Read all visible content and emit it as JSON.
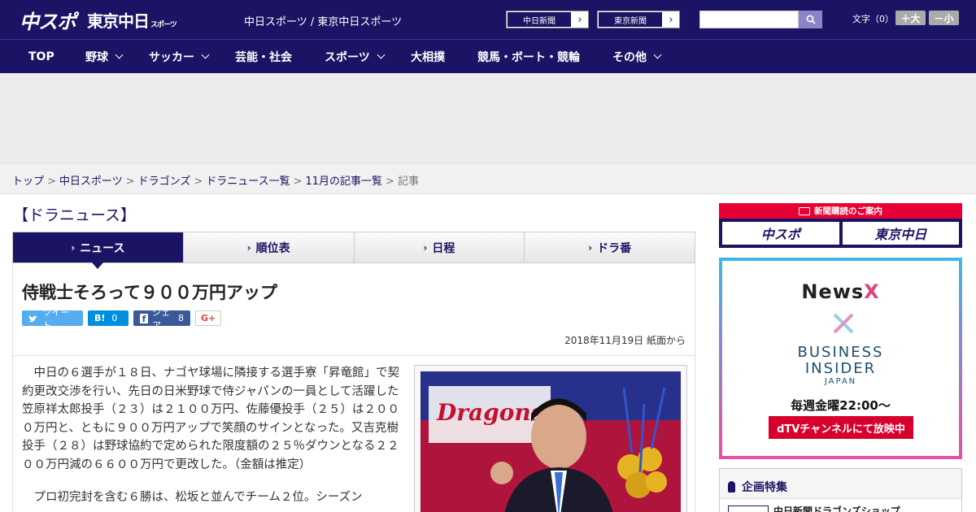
{
  "header": {
    "logo_chuspo": "中スポ",
    "logo_tokyo": "東京中日",
    "logo_tokyo_suffix": "スポーツ",
    "site_name": "中日スポーツ / 東京中日スポーツ",
    "ext_links": [
      {
        "label": "中日新聞",
        "arrow": "›"
      },
      {
        "label": "東京新聞",
        "arrow": "›"
      }
    ],
    "search_placeholder": "",
    "fontsize_label": "文字（0）",
    "fontsize_up": "＋大",
    "fontsize_down": "－小"
  },
  "nav": [
    {
      "label": "TOP",
      "has_menu": false
    },
    {
      "label": "野球",
      "has_menu": true
    },
    {
      "label": "サッカー",
      "has_menu": true
    },
    {
      "label": "芸能・社会",
      "has_menu": false
    },
    {
      "label": "スポーツ",
      "has_menu": true
    },
    {
      "label": "大相撲",
      "has_menu": false
    },
    {
      "label": "競馬・ボート・競輪",
      "has_menu": false
    },
    {
      "label": "その他",
      "has_menu": true
    }
  ],
  "breadcrumb": {
    "items": [
      "トップ",
      "中日スポーツ",
      "ドラゴンズ",
      "ドラニュース一覧",
      "11月の記事一覧"
    ],
    "separator": ">",
    "current": "記事"
  },
  "section_title": "【ドラニュース】",
  "tabs": [
    {
      "label": "ニュース",
      "caret": "›",
      "active": true
    },
    {
      "label": "順位表",
      "caret": "›",
      "active": false
    },
    {
      "label": "日程",
      "caret": "›",
      "active": false
    },
    {
      "label": "ドラ番",
      "caret": "›",
      "active": false
    }
  ],
  "article": {
    "headline": "侍戦士そろって９００万円アップ",
    "share": {
      "tweet_label": "ツイート",
      "hatena_label": "B!",
      "hatena_count": "0",
      "facebook_label": "シェア",
      "facebook_count": "8",
      "gplus_label": "G+"
    },
    "dateline": "2018年11月19日 紙面から",
    "paragraphs": [
      "中日の６選手が１８日、ナゴヤ球場に隣接する選手寮「昇竜館」で契約更改交渉を行い、先日の日米野球で侍ジャパンの一員として活躍した笠原祥太郎投手（２３）は２１００万円、佐藤優投手（２５）は２０００万円と、ともに９００万円アップで笑顔のサインとなった。又吉克樹投手（２８）は野球協約で定められた限度額の２５％ダウンとなる２２００万円減の６６００万円で更改した。（金額は推定）",
      "プロ初完封を含む６勝は、松坂と並んでチーム２位。シーズン"
    ],
    "photo_text": "Dragons"
  },
  "sidebar": {
    "subscribe_title": "新聞購読のご案内",
    "subscribe_logos": [
      "中スポ",
      "東京中日"
    ],
    "ad": {
      "newsx_main": "NewsX",
      "business": "BUSINESS",
      "insider": "INSIDER",
      "japan": "JAPAN",
      "time": "毎週金曜22:00〜",
      "cta": "dTVチャンネルにて放映中"
    },
    "feature_title": "企画特集",
    "feature_link": "中日新聞ドラゴンズショップ"
  },
  "colors": {
    "brand_navy": "#1b1464",
    "accent_red": "#e60033",
    "twitter": "#55acee",
    "hatena": "#008fde",
    "facebook": "#3b5998"
  }
}
